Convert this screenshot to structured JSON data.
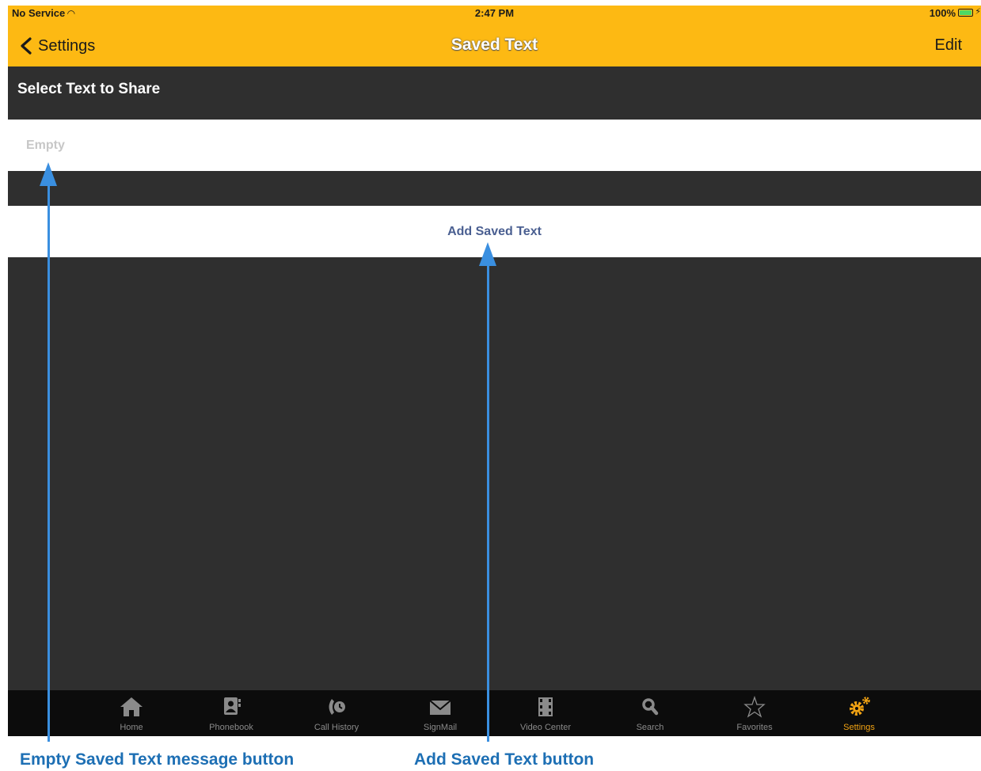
{
  "status_bar": {
    "carrier": "No Service",
    "time": "2:47 PM",
    "battery": "100%"
  },
  "nav": {
    "back_label": "Settings",
    "title": "Saved Text",
    "edit_label": "Edit"
  },
  "section": {
    "header": "Select Text to Share"
  },
  "list": {
    "empty_label": "Empty",
    "add_label": "Add Saved Text"
  },
  "tabbar": {
    "items": [
      {
        "label": "Home",
        "icon": "home-icon"
      },
      {
        "label": "Phonebook",
        "icon": "phonebook-icon"
      },
      {
        "label": "Call History",
        "icon": "call-history-icon"
      },
      {
        "label": "SignMail",
        "icon": "mail-icon"
      },
      {
        "label": "Video Center",
        "icon": "film-icon"
      },
      {
        "label": "Search",
        "icon": "search-icon"
      },
      {
        "label": "Favorites",
        "icon": "star-icon"
      },
      {
        "label": "Settings",
        "icon": "gear-icon",
        "active": true
      }
    ],
    "active_color": "#f2a313"
  },
  "annotations": {
    "empty_caption": "Empty Saved Text message button",
    "add_caption": "Add Saved Text button",
    "arrow_color": "#3a8fe0"
  },
  "colors": {
    "topbar": "#fdb913",
    "background": "#2f2f2f",
    "link": "#4a5f91"
  }
}
